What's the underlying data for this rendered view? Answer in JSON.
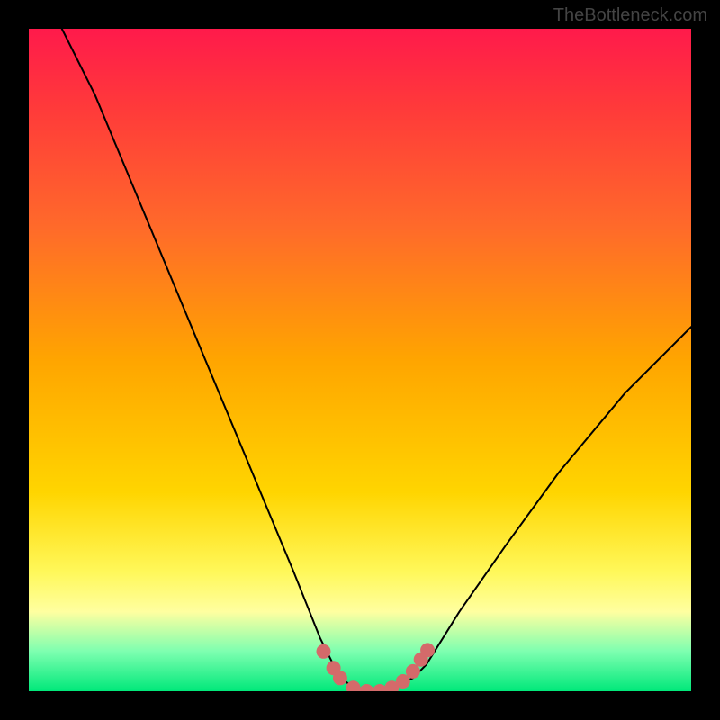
{
  "watermark": "TheBottleneck.com",
  "chart_data": {
    "type": "line",
    "title": "",
    "xlabel": "",
    "ylabel": "",
    "xlim": [
      0,
      1
    ],
    "ylim": [
      0,
      1
    ],
    "series": [
      {
        "name": "bottleneck-curve",
        "x": [
          0.05,
          0.1,
          0.15,
          0.2,
          0.25,
          0.3,
          0.35,
          0.4,
          0.44,
          0.47,
          0.5,
          0.54,
          0.58,
          0.6,
          0.65,
          0.72,
          0.8,
          0.9,
          1.0
        ],
        "y": [
          1.0,
          0.9,
          0.78,
          0.66,
          0.54,
          0.42,
          0.3,
          0.18,
          0.08,
          0.02,
          0.0,
          0.0,
          0.02,
          0.04,
          0.12,
          0.22,
          0.33,
          0.45,
          0.55
        ]
      }
    ],
    "markers": {
      "name": "highlight-dots",
      "color": "#d46a6a",
      "points": [
        {
          "x": 0.445,
          "y": 0.06
        },
        {
          "x": 0.46,
          "y": 0.035
        },
        {
          "x": 0.47,
          "y": 0.02
        },
        {
          "x": 0.49,
          "y": 0.005
        },
        {
          "x": 0.51,
          "y": 0.0
        },
        {
          "x": 0.53,
          "y": 0.0
        },
        {
          "x": 0.548,
          "y": 0.005
        },
        {
          "x": 0.565,
          "y": 0.015
        },
        {
          "x": 0.58,
          "y": 0.03
        },
        {
          "x": 0.592,
          "y": 0.048
        },
        {
          "x": 0.602,
          "y": 0.062
        }
      ]
    },
    "legend": null,
    "grid": false
  }
}
